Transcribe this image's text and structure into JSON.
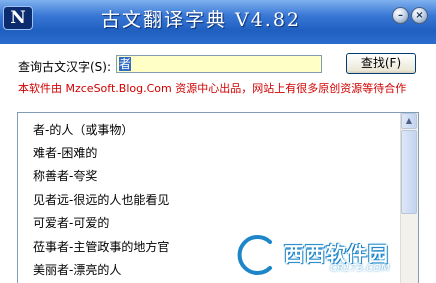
{
  "window": {
    "logo_glyph": "N",
    "title": "古文翻译字典 V4.82",
    "minimize_glyph": "–",
    "close_glyph": "×"
  },
  "search": {
    "label": "查询古文汉字(S):",
    "value": "者",
    "button_label": "查找(F)"
  },
  "promo_text": "本软件由 MzceSoft.Blog.Com 资源中心出品，网站上有很多原创资源等待合作",
  "results": [
    "者-的人（或事物）",
    "难者-困难的",
    "称善者-夸奖",
    "见者远-很远的人也能看见",
    "可爱者-可爱的",
    "莅事者-主管政事的地方官",
    "美丽者-漂亮的人"
  ],
  "watermark": {
    "brand": "西西软件园",
    "domain": "CR173.COM"
  },
  "colors": {
    "title_bar": "#2b6dcc",
    "promo_text": "#d00000",
    "search_input_bg": "#ffffc6"
  }
}
